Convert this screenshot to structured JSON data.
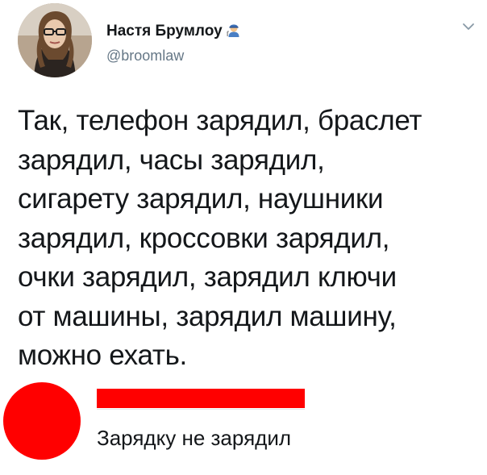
{
  "tweet": {
    "author_name": "Настя Брумлоу",
    "author_handle": "@broomlaw",
    "badge_icon": "mechanic-emoji-icon",
    "menu_icon": "chevron-down-icon",
    "lines": [
      "Так, телефон зарядил, браслет",
      "зарядил, часы зарядил,",
      "сигарету зарядил, наушники",
      "зарядил, кроссовки зарядил,",
      "очки зарядил, зарядил ключи",
      "от машины, зарядил машину,",
      "можно ехать."
    ]
  },
  "reply": {
    "avatar_color": "#ff0000",
    "redaction_color": "#ff0000",
    "text": "Зарядку не зарядил"
  }
}
